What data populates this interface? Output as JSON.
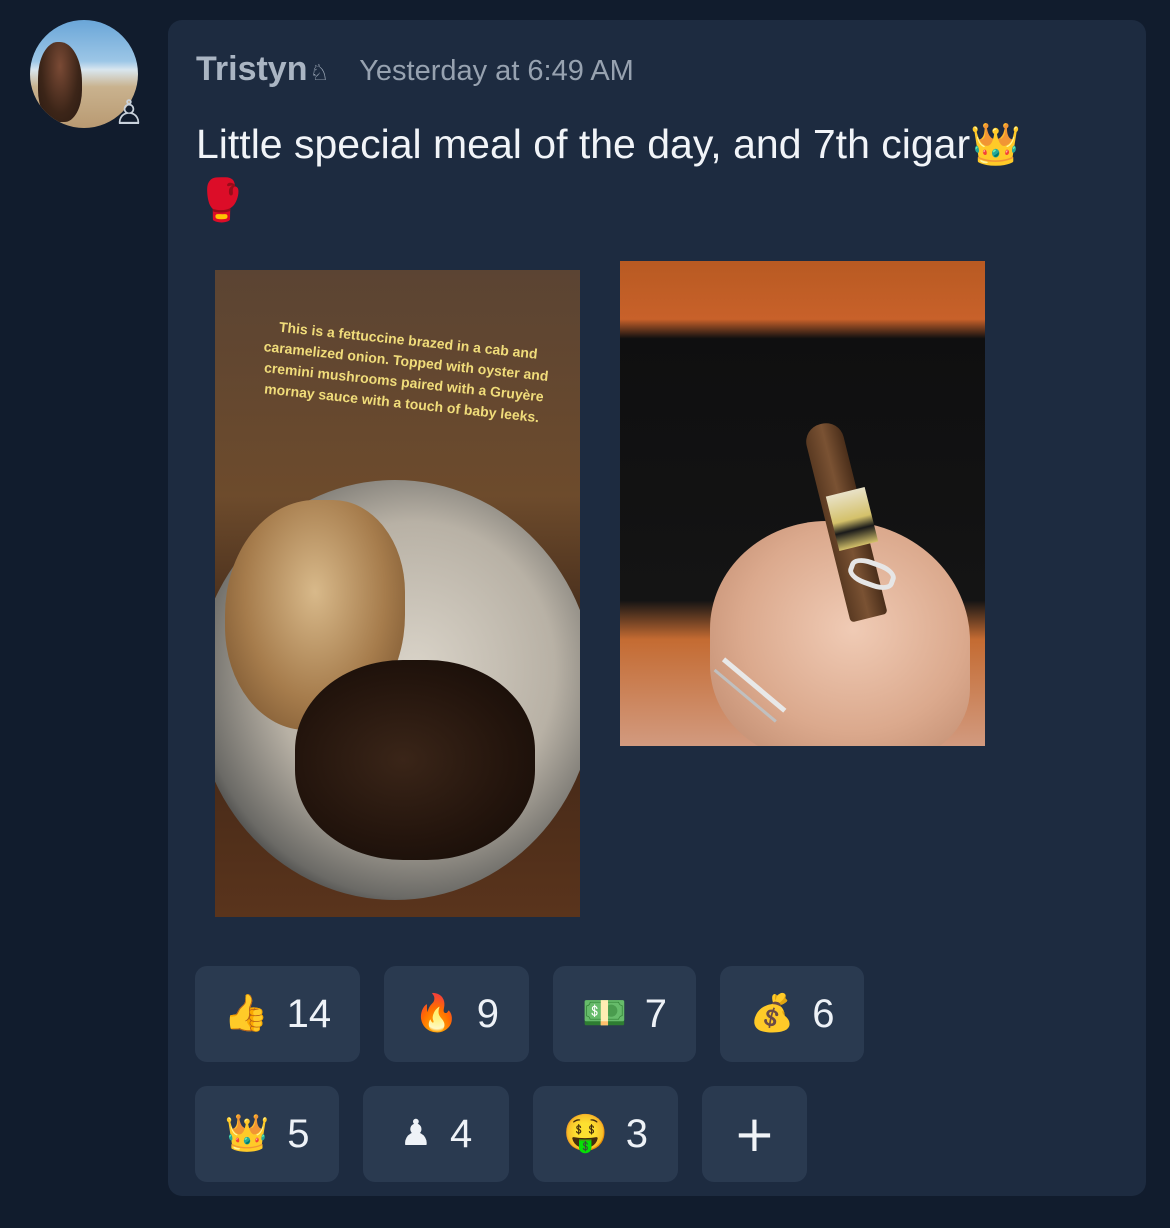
{
  "post": {
    "username": "Tristyn",
    "username_icon": "♘",
    "status_icon": "♙",
    "timestamp": "Yesterday at 6:49 AM",
    "message_text": "Little special meal of the day, and 7th cigar",
    "message_emoji_1": "👑",
    "message_emoji_2": "🥊"
  },
  "images": [
    {
      "subject": "food-photo",
      "caption": "This is a fettuccine brazed in a cab and caramelized onion. Topped with oyster and cremini mushrooms paired with a Gruyère mornay sauce with a touch of baby leeks."
    },
    {
      "subject": "cigar-photo"
    }
  ],
  "reactions": [
    {
      "emoji": "👍",
      "count": "14",
      "icon_name": "thumbs-up-icon"
    },
    {
      "emoji": "🔥",
      "count": "9",
      "icon_name": "fire-icon"
    },
    {
      "emoji": "💵",
      "count": "7",
      "icon_name": "money-bill-icon"
    },
    {
      "emoji": "💰",
      "count": "6",
      "icon_name": "money-bag-icon"
    },
    {
      "emoji": "👑",
      "count": "5",
      "icon_name": "crown-icon"
    },
    {
      "emoji": "♟",
      "count": "4",
      "icon_name": "chess-pawn-icon"
    },
    {
      "emoji": "🤑",
      "count": "3",
      "icon_name": "money-mouth-face-icon"
    }
  ],
  "add_reaction_label": "+"
}
